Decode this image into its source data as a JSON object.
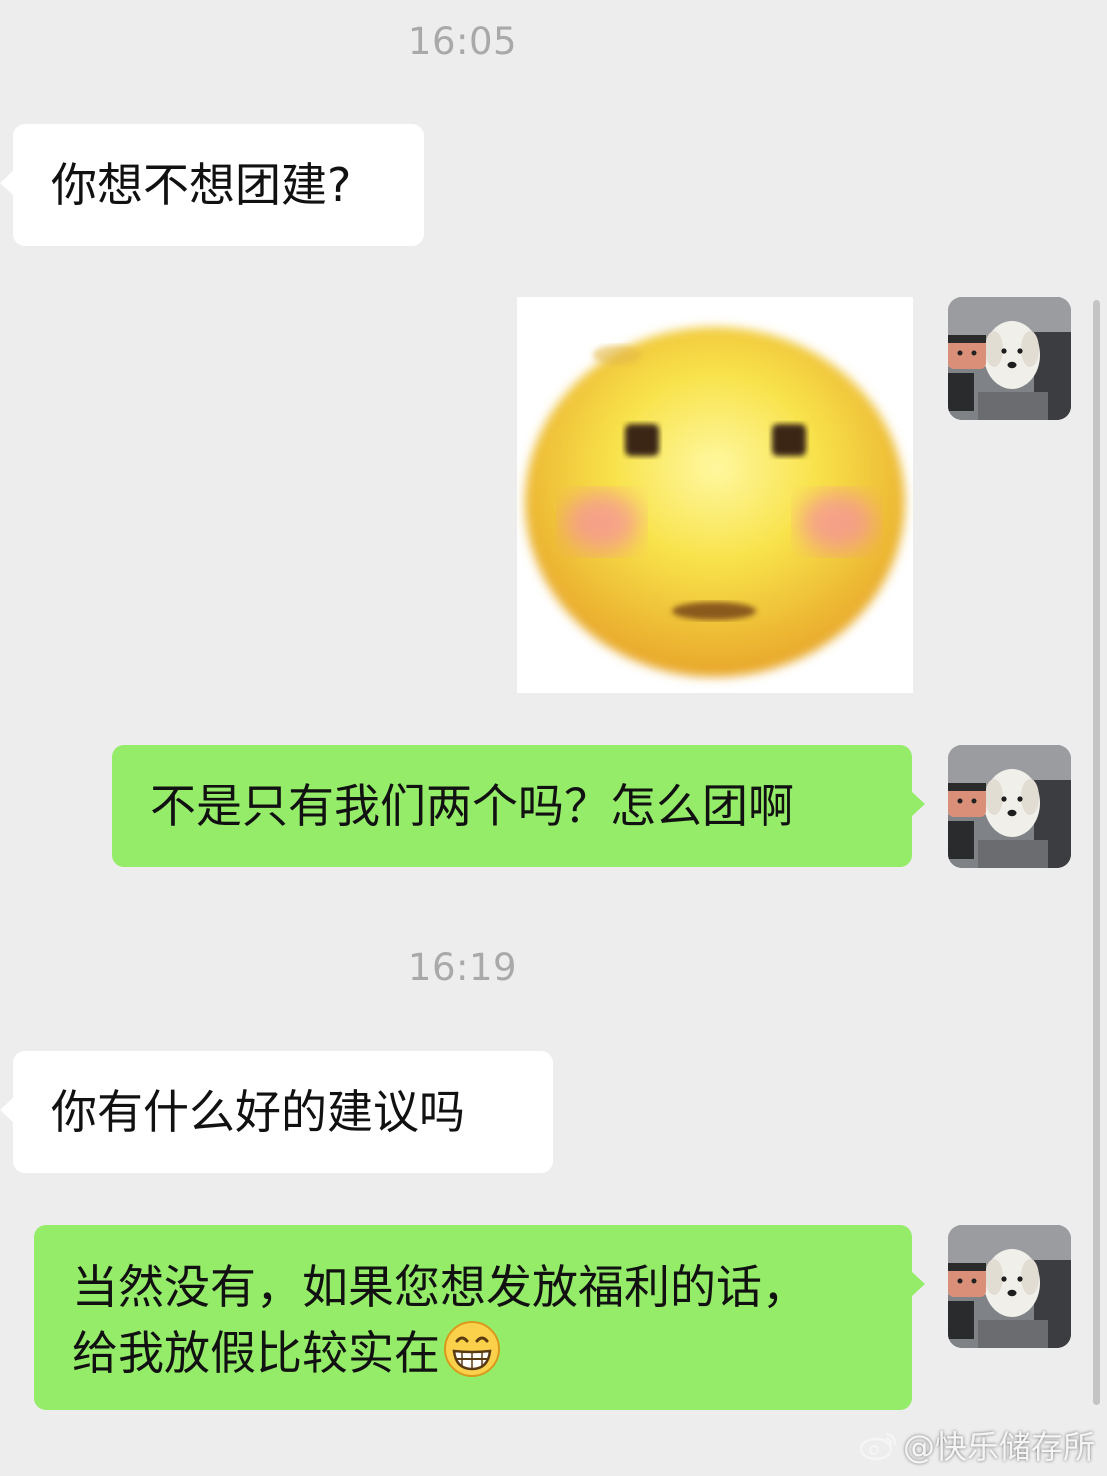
{
  "conversation": {
    "messages": [
      {
        "type": "timestamp",
        "text": "16:05"
      },
      {
        "type": "text",
        "side": "left",
        "text": "你想不想团建?"
      },
      {
        "type": "sticker",
        "side": "right",
        "sticker": "blushing-face-sticker"
      },
      {
        "type": "text",
        "side": "right",
        "text": "不是只有我们两个吗？怎么团啊"
      },
      {
        "type": "timestamp",
        "text": "16:19"
      },
      {
        "type": "text",
        "side": "left",
        "text": "你有什么好的建议吗"
      },
      {
        "type": "text",
        "side": "right",
        "lines": [
          "当然没有，如果您想发放福利的话，",
          "给我放假比较实在"
        ],
        "emoji": "grinning-face-emoji"
      }
    ]
  },
  "watermark": {
    "text": "@快乐储存所",
    "icon": "weibo-icon"
  },
  "colors": {
    "background": "#ededed",
    "incoming_bubble": "#ffffff",
    "outgoing_bubble": "#95ec69",
    "timestamp": "#a9a9a9"
  }
}
